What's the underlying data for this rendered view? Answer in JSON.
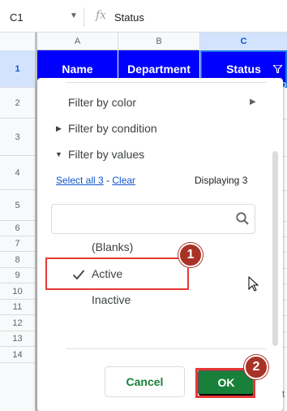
{
  "formula_bar": {
    "name_box": "C1",
    "fx": "fx",
    "value": "Status"
  },
  "columns": [
    "A",
    "B",
    "C"
  ],
  "rows": [
    "1",
    "2",
    "3",
    "4",
    "5",
    "6",
    "7",
    "8",
    "9",
    "10",
    "11",
    "12",
    "13",
    "14"
  ],
  "header_cells": {
    "a": "Name",
    "b": "Department",
    "c": "Status"
  },
  "filter_menu": {
    "filter_by_color": "Filter by color",
    "filter_by_condition": "Filter by condition",
    "filter_by_values": "Filter by values",
    "select_all": "Select all 3",
    "separator": " - ",
    "clear": "Clear",
    "displaying": "Displaying 3",
    "search_placeholder": "",
    "values": [
      {
        "label": "(Blanks)",
        "checked": false
      },
      {
        "label": "Active",
        "checked": true
      },
      {
        "label": "Inactive",
        "checked": false
      }
    ],
    "cancel": "Cancel",
    "ok": "OK"
  },
  "annotations": {
    "badge_1": "1",
    "badge_2": "2"
  },
  "edge_text": "t",
  "colors": {
    "header_blue": "#0000ff",
    "ok_green": "#188038",
    "annotation_red": "#e53935",
    "badge_red": "#a93226",
    "selection_blue": "#1a73e8"
  },
  "icons": [
    "dropdown-caret-icon",
    "function-icon",
    "filter-icon",
    "chevron-right-icon",
    "triangle-right-icon",
    "triangle-down-icon",
    "search-icon",
    "check-icon",
    "mouse-cursor-icon"
  ]
}
